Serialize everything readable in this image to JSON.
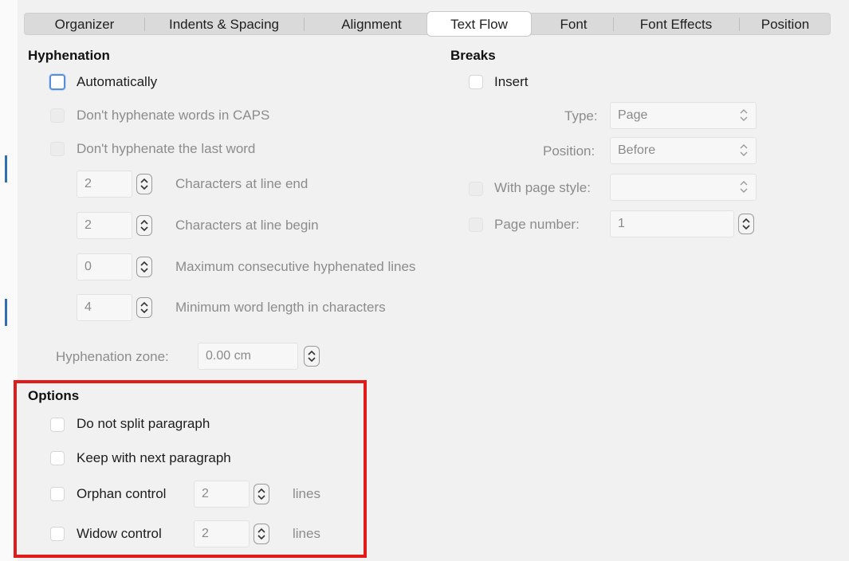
{
  "tabs": [
    {
      "label": "Organizer",
      "active": false
    },
    {
      "label": "Indents & Spacing",
      "active": false
    },
    {
      "label": "Alignment",
      "active": false
    },
    {
      "label": "Text Flow",
      "active": true
    },
    {
      "label": "Font",
      "active": false
    },
    {
      "label": "Font Effects",
      "active": false
    },
    {
      "label": "Position",
      "active": false
    }
  ],
  "hyphenation": {
    "heading": "Hyphenation",
    "automatically": "Automatically",
    "caps": "Don't hyphenate words in CAPS",
    "last_word": "Don't hyphenate the last word",
    "spinners": [
      {
        "value": "2",
        "label": "Characters at line end"
      },
      {
        "value": "2",
        "label": "Characters at line begin"
      },
      {
        "value": "0",
        "label": "Maximum consecutive hyphenated lines"
      },
      {
        "value": "4",
        "label": "Minimum word length in characters"
      }
    ],
    "zone_label": "Hyphenation zone:",
    "zone_value": "0.00 cm"
  },
  "breaks": {
    "heading": "Breaks",
    "insert": "Insert",
    "type_label": "Type:",
    "type_value": "Page",
    "position_label": "Position:",
    "position_value": "Before",
    "page_style_label": "With page style:",
    "page_style_value": "",
    "page_number_label": "Page number:",
    "page_number_value": "1"
  },
  "options": {
    "heading": "Options",
    "no_split": "Do not split paragraph",
    "keep_next": "Keep with next paragraph",
    "orphan_label": "Orphan control",
    "orphan_value": "2",
    "orphan_unit": "lines",
    "widow_label": "Widow control",
    "widow_value": "2",
    "widow_unit": "lines"
  },
  "colors": {
    "highlight": "#e11a1a",
    "focus": "#5b8ed8"
  }
}
